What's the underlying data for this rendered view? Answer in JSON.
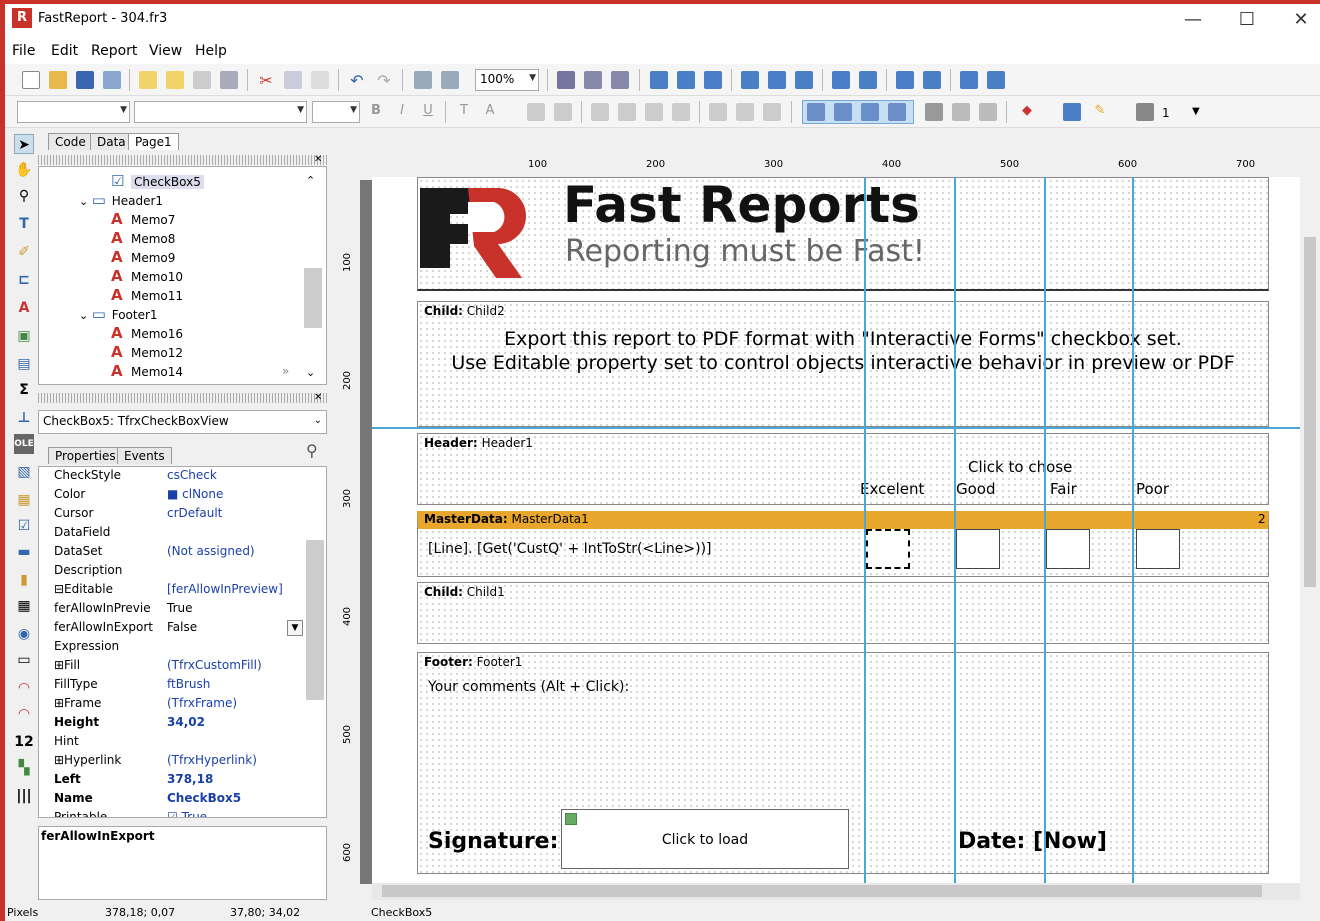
{
  "window": {
    "title": "FastReport - 304.fr3",
    "minimize": "—",
    "maximize": "☐",
    "close": "✕"
  },
  "menu": [
    "File",
    "Edit",
    "Report",
    "View",
    "Help"
  ],
  "toolbar": {
    "zoom": "100%",
    "frame_width": "1"
  },
  "tabs": [
    "Code",
    "Data",
    "Page1"
  ],
  "tree": [
    {
      "label": "CheckBox5",
      "kind": "check",
      "indent": 3
    },
    {
      "label": "Header1",
      "kind": "band",
      "indent": 2
    },
    {
      "label": "Memo7",
      "kind": "memo",
      "indent": 3
    },
    {
      "label": "Memo8",
      "kind": "memo",
      "indent": 3
    },
    {
      "label": "Memo9",
      "kind": "memo",
      "indent": 3
    },
    {
      "label": "Memo10",
      "kind": "memo",
      "indent": 3
    },
    {
      "label": "Memo11",
      "kind": "memo",
      "indent": 3
    },
    {
      "label": "Footer1",
      "kind": "band",
      "indent": 2
    },
    {
      "label": "Memo16",
      "kind": "memo",
      "indent": 3
    },
    {
      "label": "Memo12",
      "kind": "memo",
      "indent": 3
    },
    {
      "label": "Memo14",
      "kind": "memo",
      "indent": 3
    }
  ],
  "object_selector": "CheckBox5: TfrxCheckBoxView",
  "prop_tabs": [
    "Properties",
    "Events"
  ],
  "properties": [
    {
      "name": "CheckStyle",
      "value": "csCheck"
    },
    {
      "name": "Color",
      "value": "■ clNone"
    },
    {
      "name": "Cursor",
      "value": "crDefault"
    },
    {
      "name": "DataField",
      "value": ""
    },
    {
      "name": "DataSet",
      "value": "(Not assigned)"
    },
    {
      "name": "Description",
      "value": ""
    },
    {
      "name": "⊟Editable",
      "value": "[ferAllowInPreview]"
    },
    {
      "name": "   ferAllowInPrevie",
      "value": "True"
    },
    {
      "name": "   ferAllowInExport",
      "value": "False"
    },
    {
      "name": "Expression",
      "value": ""
    },
    {
      "name": "⊞Fill",
      "value": "(TfrxCustomFill)"
    },
    {
      "name": "FillType",
      "value": "ftBrush"
    },
    {
      "name": "⊞Frame",
      "value": "(TfrxFrame)"
    },
    {
      "name": "Height",
      "value": "34,02",
      "bold": true
    },
    {
      "name": "Hint",
      "value": ""
    },
    {
      "name": "⊞Hyperlink",
      "value": "(TfrxHyperlink)"
    },
    {
      "name": "Left",
      "value": "378,18",
      "bold": true
    },
    {
      "name": "Name",
      "value": "CheckBox5",
      "bold": true
    },
    {
      "name": "Printable",
      "value": "☑ True"
    }
  ],
  "prop_description": "ferAllowInExport",
  "status": {
    "units": "Pixels",
    "pos": "378,18; 0,07",
    "size": "37,80; 34,02",
    "object": "CheckBox5"
  },
  "ruler": {
    "top": [
      "100",
      "200",
      "300",
      "400",
      "500",
      "600",
      "700"
    ],
    "left": [
      "100",
      "200",
      "300",
      "400",
      "500",
      "600"
    ]
  },
  "report": {
    "logo_title": "Fast Reports",
    "logo_sub": "Reporting must be Fast!",
    "child2_label": "Child:",
    "child2_name": "Child2",
    "child2_text1": "Export this report to PDF format with \"Interactive Forms\" checkbox set.",
    "child2_text2": "Use Editable property set to control objects interactive behavior in preview or PDF",
    "header_label": "Header:",
    "header_name": "Header1",
    "header_prompt": "Click to chose",
    "header_options": [
      "Excelent",
      "Good",
      "Fair",
      "Poor"
    ],
    "master_label": "MasterData:",
    "master_name": "MasterData1",
    "master_badge": "2",
    "master_expr": "[Line]. [Get('CustQ' + IntToStr(<Line>))]",
    "child1_label": "Child:",
    "child1_name": "Child1",
    "footer_label": "Footer:",
    "footer_name": "Footer1",
    "footer_comments": "Your comments (Alt + Click):",
    "signature": "Signature:",
    "click_load": "Click to load",
    "date": "Date: [Now]"
  },
  "colors": {
    "accent": "#c8322a",
    "master_band": "#e8a62c",
    "guide": "#4aa8d8",
    "value_text": "#1a3fa8"
  }
}
